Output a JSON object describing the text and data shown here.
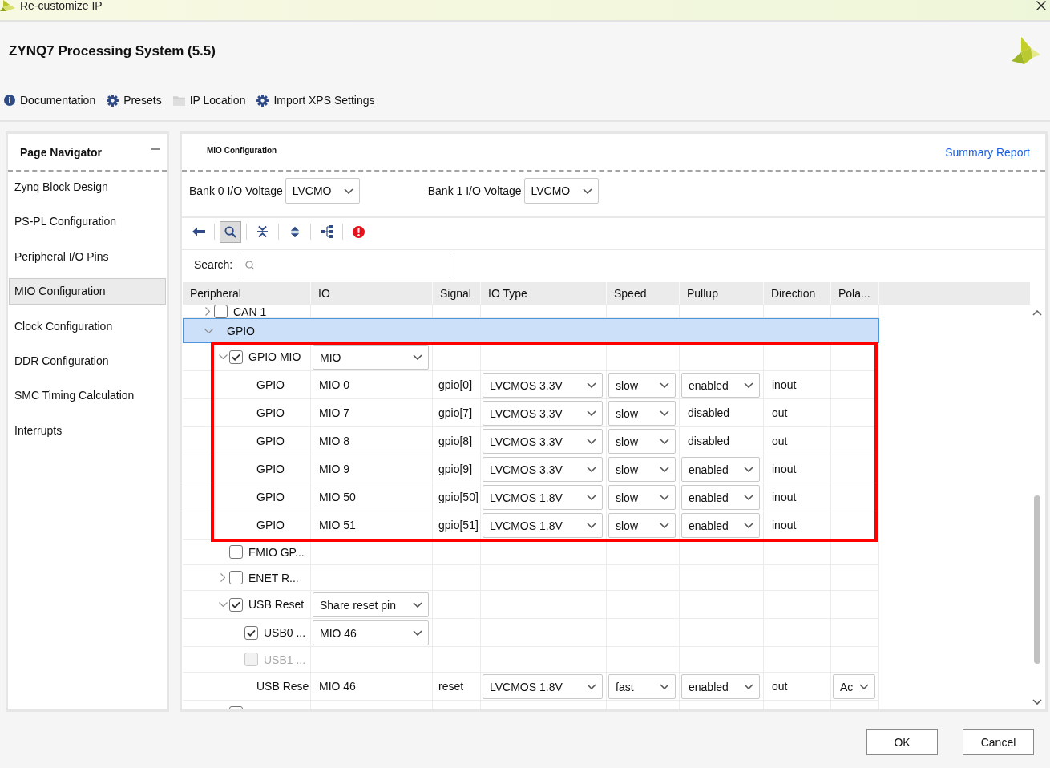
{
  "window": {
    "title": "Re-customize IP"
  },
  "ip": {
    "title": "ZYNQ7 Processing System (5.5)"
  },
  "header_links": [
    {
      "label": "Documentation"
    },
    {
      "label": "Presets"
    },
    {
      "label": "IP Location"
    },
    {
      "label": "Import XPS Settings"
    }
  ],
  "page_navigator": {
    "title": "Page Navigator",
    "items": [
      {
        "label": "Zynq Block Design",
        "selected": false
      },
      {
        "label": "PS-PL Configuration",
        "selected": false
      },
      {
        "label": "Peripheral I/O Pins",
        "selected": false
      },
      {
        "label": "MIO Configuration",
        "selected": true
      },
      {
        "label": "Clock Configuration",
        "selected": false
      },
      {
        "label": "DDR Configuration",
        "selected": false
      },
      {
        "label": "SMC Timing Calculation",
        "selected": false
      },
      {
        "label": "Interrupts",
        "selected": false
      }
    ]
  },
  "content": {
    "title": "MIO Configuration",
    "summary_link": "Summary Report",
    "bank_voltages": [
      {
        "label": "Bank 0 I/O Voltage",
        "value": "LVCMO"
      },
      {
        "label": "Bank 1 I/O Voltage",
        "value": "LVCMO"
      }
    ],
    "toolbar": [
      {
        "selected": false
      },
      {
        "selected": true
      },
      {
        "selected": false
      },
      {
        "selected": false
      },
      {
        "selected": false
      },
      {
        "selected": false
      }
    ],
    "search": {
      "label": "Search:"
    },
    "table": {
      "columns": [
        "Peripheral",
        "IO",
        "Signal",
        "IO Type",
        "Speed",
        "Pullup",
        "Direction",
        "Pola..."
      ],
      "rows": [
        {
          "kind": "option",
          "label": "CAN 1",
          "checked": false,
          "disabled": false,
          "expanded": false,
          "selected": false,
          "highlighted": false
        },
        {
          "kind": "group",
          "label": "GPIO",
          "expanded": true,
          "selected": true,
          "children": [
            {
              "kind": "option",
              "label": "GPIO MIO",
              "checked": true,
              "disabled": false,
              "expanded": true,
              "selected": false,
              "highlighted": true,
              "value": "MIO",
              "children": [
                {
                  "kind": "pin",
                  "peripheral": "GPIO",
                  "io": "MIO 0",
                  "signal": "gpio[0]",
                  "io_type": "LVCMOS 3.3V",
                  "speed": "slow",
                  "pullup": {
                    "value": "enabled",
                    "editable": true
                  },
                  "direction": "inout",
                  "selected": false
                },
                {
                  "kind": "pin",
                  "peripheral": "GPIO",
                  "io": "MIO 7",
                  "signal": "gpio[7]",
                  "io_type": "LVCMOS 3.3V",
                  "speed": "slow",
                  "pullup": {
                    "value": "disabled",
                    "editable": false
                  },
                  "direction": "out",
                  "selected": false
                },
                {
                  "kind": "pin",
                  "peripheral": "GPIO",
                  "io": "MIO 8",
                  "signal": "gpio[8]",
                  "io_type": "LVCMOS 3.3V",
                  "speed": "slow",
                  "pullup": {
                    "value": "disabled",
                    "editable": false
                  },
                  "direction": "out",
                  "selected": false
                },
                {
                  "kind": "pin",
                  "peripheral": "GPIO",
                  "io": "MIO 9",
                  "signal": "gpio[9]",
                  "io_type": "LVCMOS 3.3V",
                  "speed": "slow",
                  "pullup": {
                    "value": "enabled",
                    "editable": true
                  },
                  "direction": "inout",
                  "selected": false
                },
                {
                  "kind": "pin",
                  "peripheral": "GPIO",
                  "io": "MIO 50",
                  "signal": "gpio[50]",
                  "io_type": "LVCMOS 1.8V",
                  "speed": "slow",
                  "pullup": {
                    "value": "enabled",
                    "editable": true
                  },
                  "direction": "inout",
                  "selected": false
                },
                {
                  "kind": "pin",
                  "peripheral": "GPIO",
                  "io": "MIO 51",
                  "signal": "gpio[51]",
                  "io_type": "LVCMOS 1.8V",
                  "speed": "slow",
                  "pullup": {
                    "value": "enabled",
                    "editable": true
                  },
                  "direction": "inout",
                  "selected": false
                }
              ]
            },
            {
              "kind": "option",
              "label": "EMIO GP...",
              "checked": false,
              "disabled": false,
              "selected": false,
              "highlighted": false
            },
            {
              "kind": "option",
              "label": "ENET R...",
              "checked": false,
              "disabled": false,
              "expanded": false,
              "selected": false,
              "highlighted": false
            },
            {
              "kind": "option",
              "label": "USB Reset",
              "checked": true,
              "disabled": false,
              "expanded": true,
              "selected": false,
              "highlighted": false,
              "value": "Share reset pin",
              "children": [
                {
                  "kind": "option",
                  "label": "USB0 ...",
                  "checked": true,
                  "disabled": false,
                  "selected": false,
                  "highlighted": false,
                  "value": "MIO 46"
                },
                {
                  "kind": "option",
                  "label": "USB1 ...",
                  "checked": false,
                  "disabled": true,
                  "selected": false,
                  "highlighted": false
                },
                {
                  "kind": "pin",
                  "peripheral": "USB Rese",
                  "io": "MIO 46",
                  "signal": "reset",
                  "io_type": "LVCMOS 1.8V",
                  "speed": "fast",
                  "pullup": {
                    "value": "enabled",
                    "editable": true
                  },
                  "direction": "out",
                  "polarity": "Ac",
                  "selected": false
                }
              ]
            },
            {
              "kind": "option",
              "checked": false,
              "disabled": false,
              "selected": false,
              "highlighted": false
            }
          ]
        }
      ]
    }
  },
  "buttons": [
    {
      "label": "OK"
    },
    {
      "label": "Cancel"
    }
  ]
}
